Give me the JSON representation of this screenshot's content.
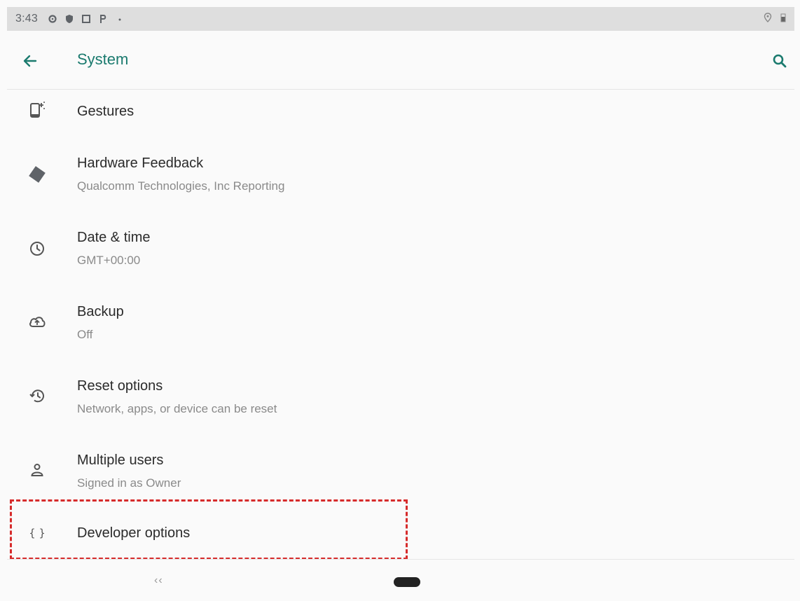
{
  "status_bar": {
    "time": "3:43",
    "left_icons": [
      "gear-icon",
      "shield-icon",
      "square-icon",
      "p-icon",
      "dot-icon"
    ],
    "right_icons": [
      "location-icon",
      "battery-icon"
    ]
  },
  "app_bar": {
    "title": "System",
    "accent_color": "#1a7a6e"
  },
  "items": [
    {
      "title": "Gestures",
      "summary": "",
      "icon": "gestures-icon"
    },
    {
      "title": "Hardware Feedback",
      "summary": "Qualcomm Technologies, Inc Reporting",
      "icon": "diamond-icon"
    },
    {
      "title": "Date & time",
      "summary": "GMT+00:00",
      "icon": "clock-icon"
    },
    {
      "title": "Backup",
      "summary": "Off",
      "icon": "cloud-upload-icon"
    },
    {
      "title": "Reset options",
      "summary": "Network, apps, or device can be reset",
      "icon": "history-icon"
    },
    {
      "title": "Multiple users",
      "summary": "Signed in as Owner",
      "icon": "person-icon"
    },
    {
      "title": "Developer options",
      "summary": "",
      "icon": "braces-icon"
    }
  ],
  "highlight_color": "#d62b2b",
  "nav_bar": {
    "back_glyph": "‹‹"
  }
}
